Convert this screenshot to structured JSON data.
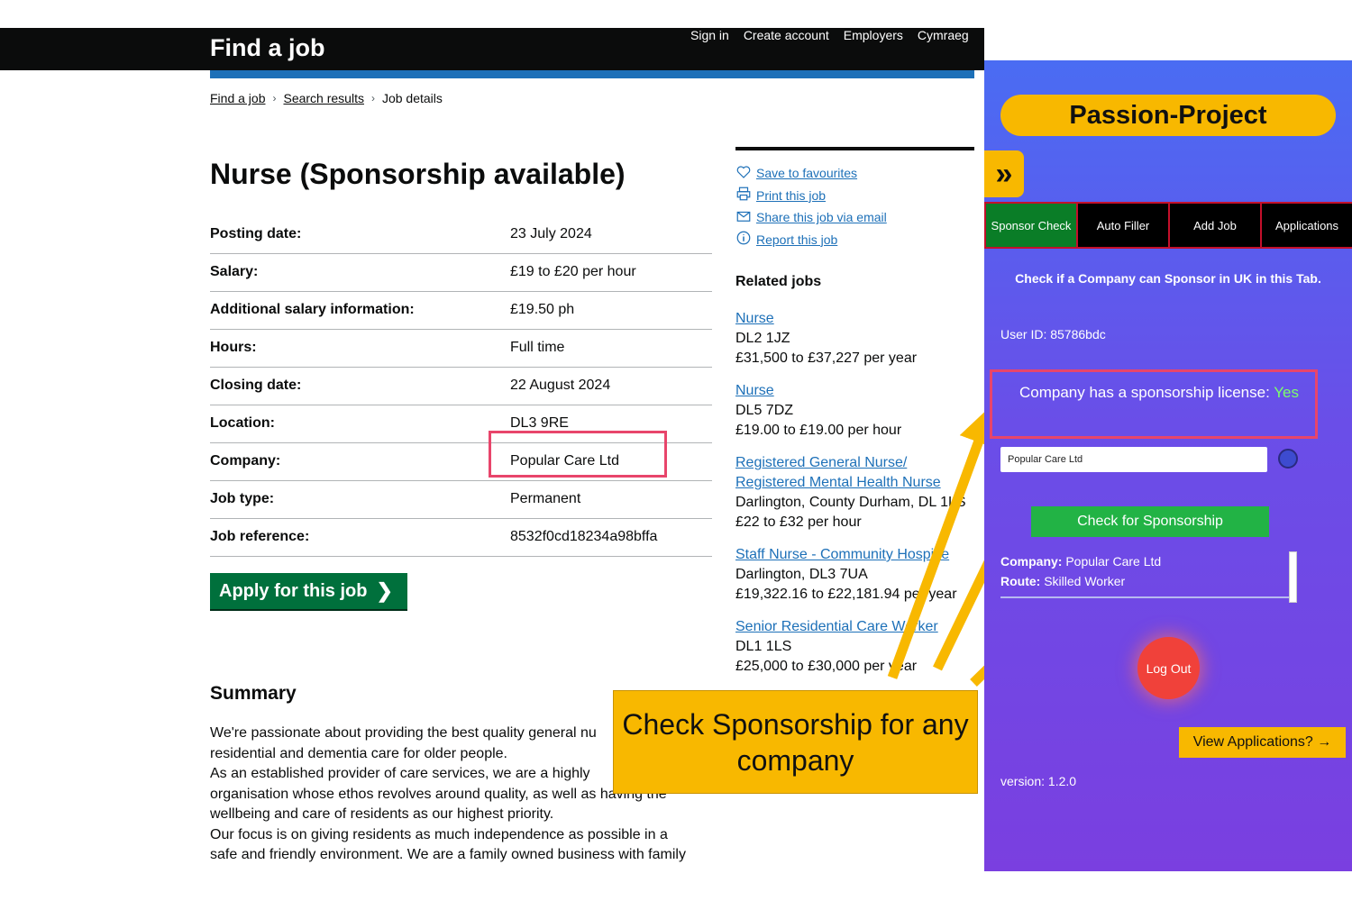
{
  "header": {
    "site_title": "Find a job",
    "nav": [
      "Sign in",
      "Create account",
      "Employers",
      "Cymraeg"
    ]
  },
  "breadcrumb": [
    "Find a job",
    "Search results",
    "Job details"
  ],
  "job": {
    "title": "Nurse (Sponsorship available)",
    "details": [
      {
        "key": "Posting date:",
        "value": "23 July 2024"
      },
      {
        "key": "Salary:",
        "value": "£19 to £20 per hour"
      },
      {
        "key": "Additional salary information:",
        "value": "£19.50 ph"
      },
      {
        "key": "Hours:",
        "value": "Full time"
      },
      {
        "key": "Closing date:",
        "value": "22 August 2024"
      },
      {
        "key": "Location:",
        "value": "DL3 9RE"
      },
      {
        "key": "Company:",
        "value": "Popular Care Ltd"
      },
      {
        "key": "Job type:",
        "value": "Permanent"
      },
      {
        "key": "Job reference:",
        "value": "8532f0cd18234a98bffa"
      }
    ],
    "apply_label": "Apply for this job",
    "summary_heading": "Summary",
    "summary_lines": [
      "We're passionate about providing the best quality general nu",
      "residential and dementia care for older people.",
      "As an established provider of care services, we are a highly",
      "organisation whose ethos revolves around quality, as well as having the",
      "wellbeing and care of residents as our highest priority.",
      "Our focus is on giving residents as much independence as possible in a",
      "safe and friendly environment. We are a family owned business with family"
    ]
  },
  "actions": [
    {
      "icon": "heart-icon",
      "label": "Save to favourites"
    },
    {
      "icon": "printer-icon",
      "label": "Print this job"
    },
    {
      "icon": "envelope-icon",
      "label": "Share this job via email"
    },
    {
      "icon": "info-icon",
      "label": "Report this job"
    }
  ],
  "related": {
    "heading": "Related jobs",
    "items": [
      {
        "title": "Nurse",
        "lines": [
          "DL2 1JZ",
          "£31,500 to £37,227 per year"
        ]
      },
      {
        "title": "Nurse",
        "lines": [
          "DL5 7DZ",
          "£19.00 to £19.00 per hour"
        ]
      },
      {
        "title": "Registered General Nurse/ Registered Mental Health Nurse",
        "lines": [
          "Darlington, County Durham, DL 1LS",
          "£22 to £32 per hour"
        ]
      },
      {
        "title": "Staff Nurse - Community Hospice",
        "lines": [
          "Darlington, DL3 7UA",
          "£19,322.16 to £22,181.94 per year"
        ]
      },
      {
        "title": "Senior Residential Care Worker",
        "lines": [
          "DL1 1LS",
          "£25,000 to £30,000 per year"
        ]
      }
    ]
  },
  "callout": {
    "text": "Check Sponsorship for any company"
  },
  "extension": {
    "title": "Passion-Project",
    "collapse_icon": "double-chevron-right-icon",
    "tabs": [
      "Sponsor Check",
      "Auto Filler",
      "Add Job",
      "Applications"
    ],
    "heading": "Check if a Company can Sponsor in UK in this Tab.",
    "user_id": "User ID: 85786bdc",
    "license_label": "Company has a sponsorship license:",
    "license_value": "Yes",
    "company_input": "Popular Care Ltd",
    "check_button": "Check for Sponsorship",
    "result_company_label": "Company:",
    "result_company_value": "Popular Care Ltd",
    "result_route_label": "Route:",
    "result_route_value": "Skilled Worker",
    "logout": "Log Out",
    "view_apps": "View Applications? →",
    "version": "version: 1.2.0"
  },
  "colors": {
    "govuk_black": "#0b0c0c",
    "govuk_blue": "#1d70b8",
    "govuk_green": "#00703c",
    "highlight_pink": "#e8456b",
    "accent_yellow": "#f8b800",
    "panel_purple": "#6a4ee8"
  }
}
